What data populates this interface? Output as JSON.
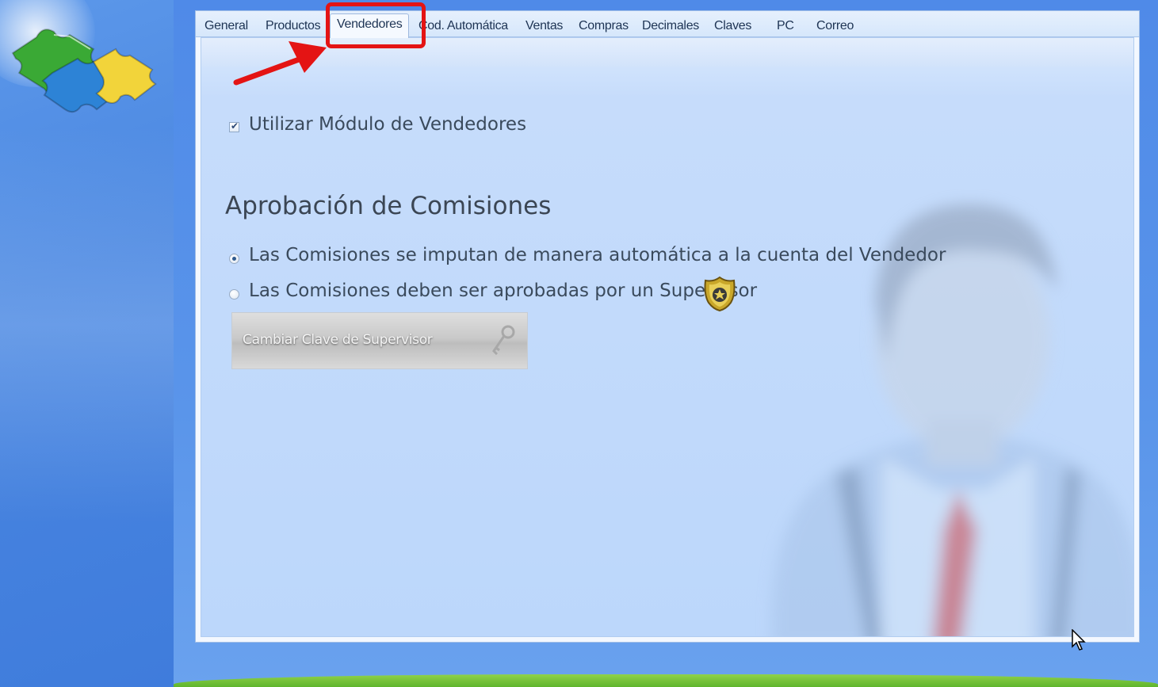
{
  "tabs": [
    {
      "label": "General"
    },
    {
      "label": "Productos"
    },
    {
      "label": "Vendedores",
      "active": true
    },
    {
      "label": "Cod. Automática"
    },
    {
      "label": "Ventas"
    },
    {
      "label": "Compras"
    },
    {
      "label": "Decimales"
    },
    {
      "label": "Claves"
    },
    {
      "label": "PC"
    },
    {
      "label": "Correo"
    }
  ],
  "vendedores": {
    "use_module": {
      "label": "Utilizar Módulo de Vendedores",
      "checked": true
    },
    "section_title": "Aprobación de Comisiones",
    "options": [
      {
        "label": "Las Comisiones se imputan de manera automática a la cuenta del Vendedor",
        "selected": true
      },
      {
        "label": "Las Comisiones deben ser aprobadas por un Supervisor",
        "selected": false
      }
    ],
    "change_password_button": "Cambiar Clave de Supervisor"
  },
  "colors": {
    "annotation": "#e41414",
    "background_blue": "#5a95ea",
    "panel_blue": "#bcd7fb"
  },
  "icons": [
    "puzzle-logo-icon",
    "supervisor-badge-icon",
    "key-icon",
    "user-silhouette-icon",
    "annotation-arrow-icon",
    "mouse-cursor-icon"
  ]
}
